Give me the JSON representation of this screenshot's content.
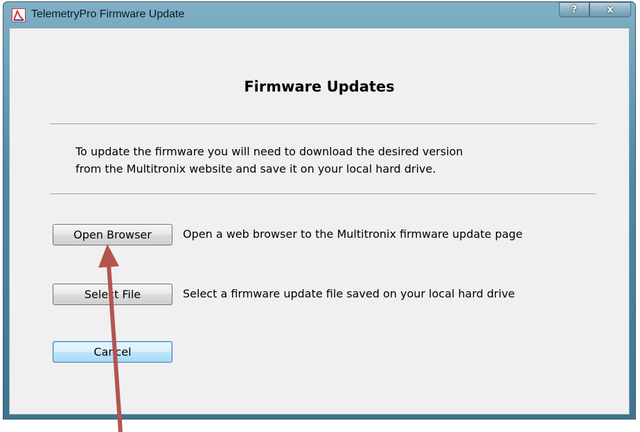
{
  "window": {
    "title": "TelemetryPro Firmware Update",
    "help_label": "?",
    "close_label": "x",
    "icon": "telemetrypro-app-icon"
  },
  "main": {
    "heading": "Firmware Updates",
    "description_line1": "To update the firmware you will need to download the desired version",
    "description_line2": "from the Multitronix website and save it on your local hard drive.",
    "open_browser": {
      "label": "Open Browser",
      "description": "Open a web browser to the Multitronix firmware update page"
    },
    "select_file": {
      "label": "Select File",
      "description": "Select a firmware update file saved on your local hard drive"
    },
    "cancel_label": "Cancel"
  },
  "annotation": {
    "icon": "red-arrow",
    "color": "#b5534f"
  }
}
